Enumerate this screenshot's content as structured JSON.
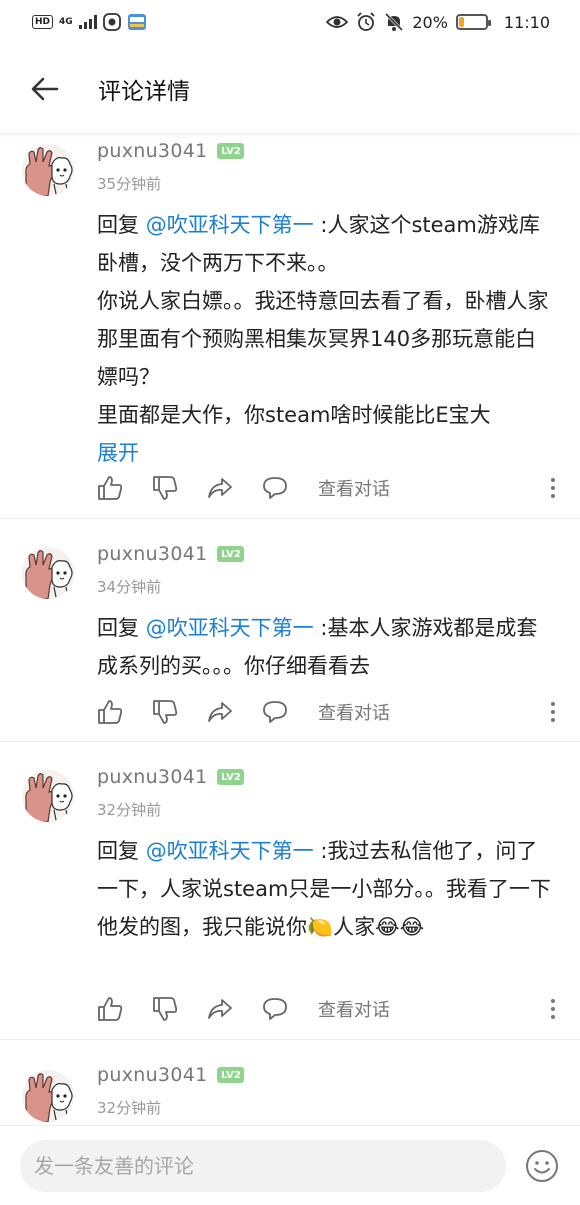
{
  "status_bar": {
    "hd": "HD",
    "signal_type": "4G",
    "battery_text": "20%",
    "battery_level": 0.2,
    "time": "11:10"
  },
  "header": {
    "title": "评论详情",
    "back_icon": "arrow-left-icon"
  },
  "comments": [
    {
      "username": "puxnu3041",
      "level": "LV2",
      "time": "35分钟前",
      "reply_prefix": "回复 ",
      "mention": "@吹亚科天下第一",
      "text": " :人家这个steam游戏库卧槽，没个两万下不来。。\n你说人家白嫖。。我还特意回去看了看，卧槽人家那里面有个预购黑相集灰冥界140多那玩意能白嫖吗？\n里面都是大作，你steam啥时候能比E宝大",
      "expand_label": "展开",
      "view_conversation": "查看对话"
    },
    {
      "username": "puxnu3041",
      "level": "LV2",
      "time": "34分钟前",
      "reply_prefix": "回复 ",
      "mention": "@吹亚科天下第一",
      "text": " :基本人家游戏都是成套成系列的买。。。你仔细看看去",
      "view_conversation": "查看对话"
    },
    {
      "username": "puxnu3041",
      "level": "LV2",
      "time": "32分钟前",
      "reply_prefix": "回复 ",
      "mention": "@吹亚科天下第一",
      "text": " :我过去私信他了，问了一下，人家说steam只是一小部分。。我看了一下他发的图，我只能说你🍋人家😂😂",
      "view_conversation": "查看对话"
    },
    {
      "username": "puxnu3041",
      "level": "LV2",
      "time": "32分钟前"
    }
  ],
  "input": {
    "placeholder": "发一条友善的评论"
  }
}
